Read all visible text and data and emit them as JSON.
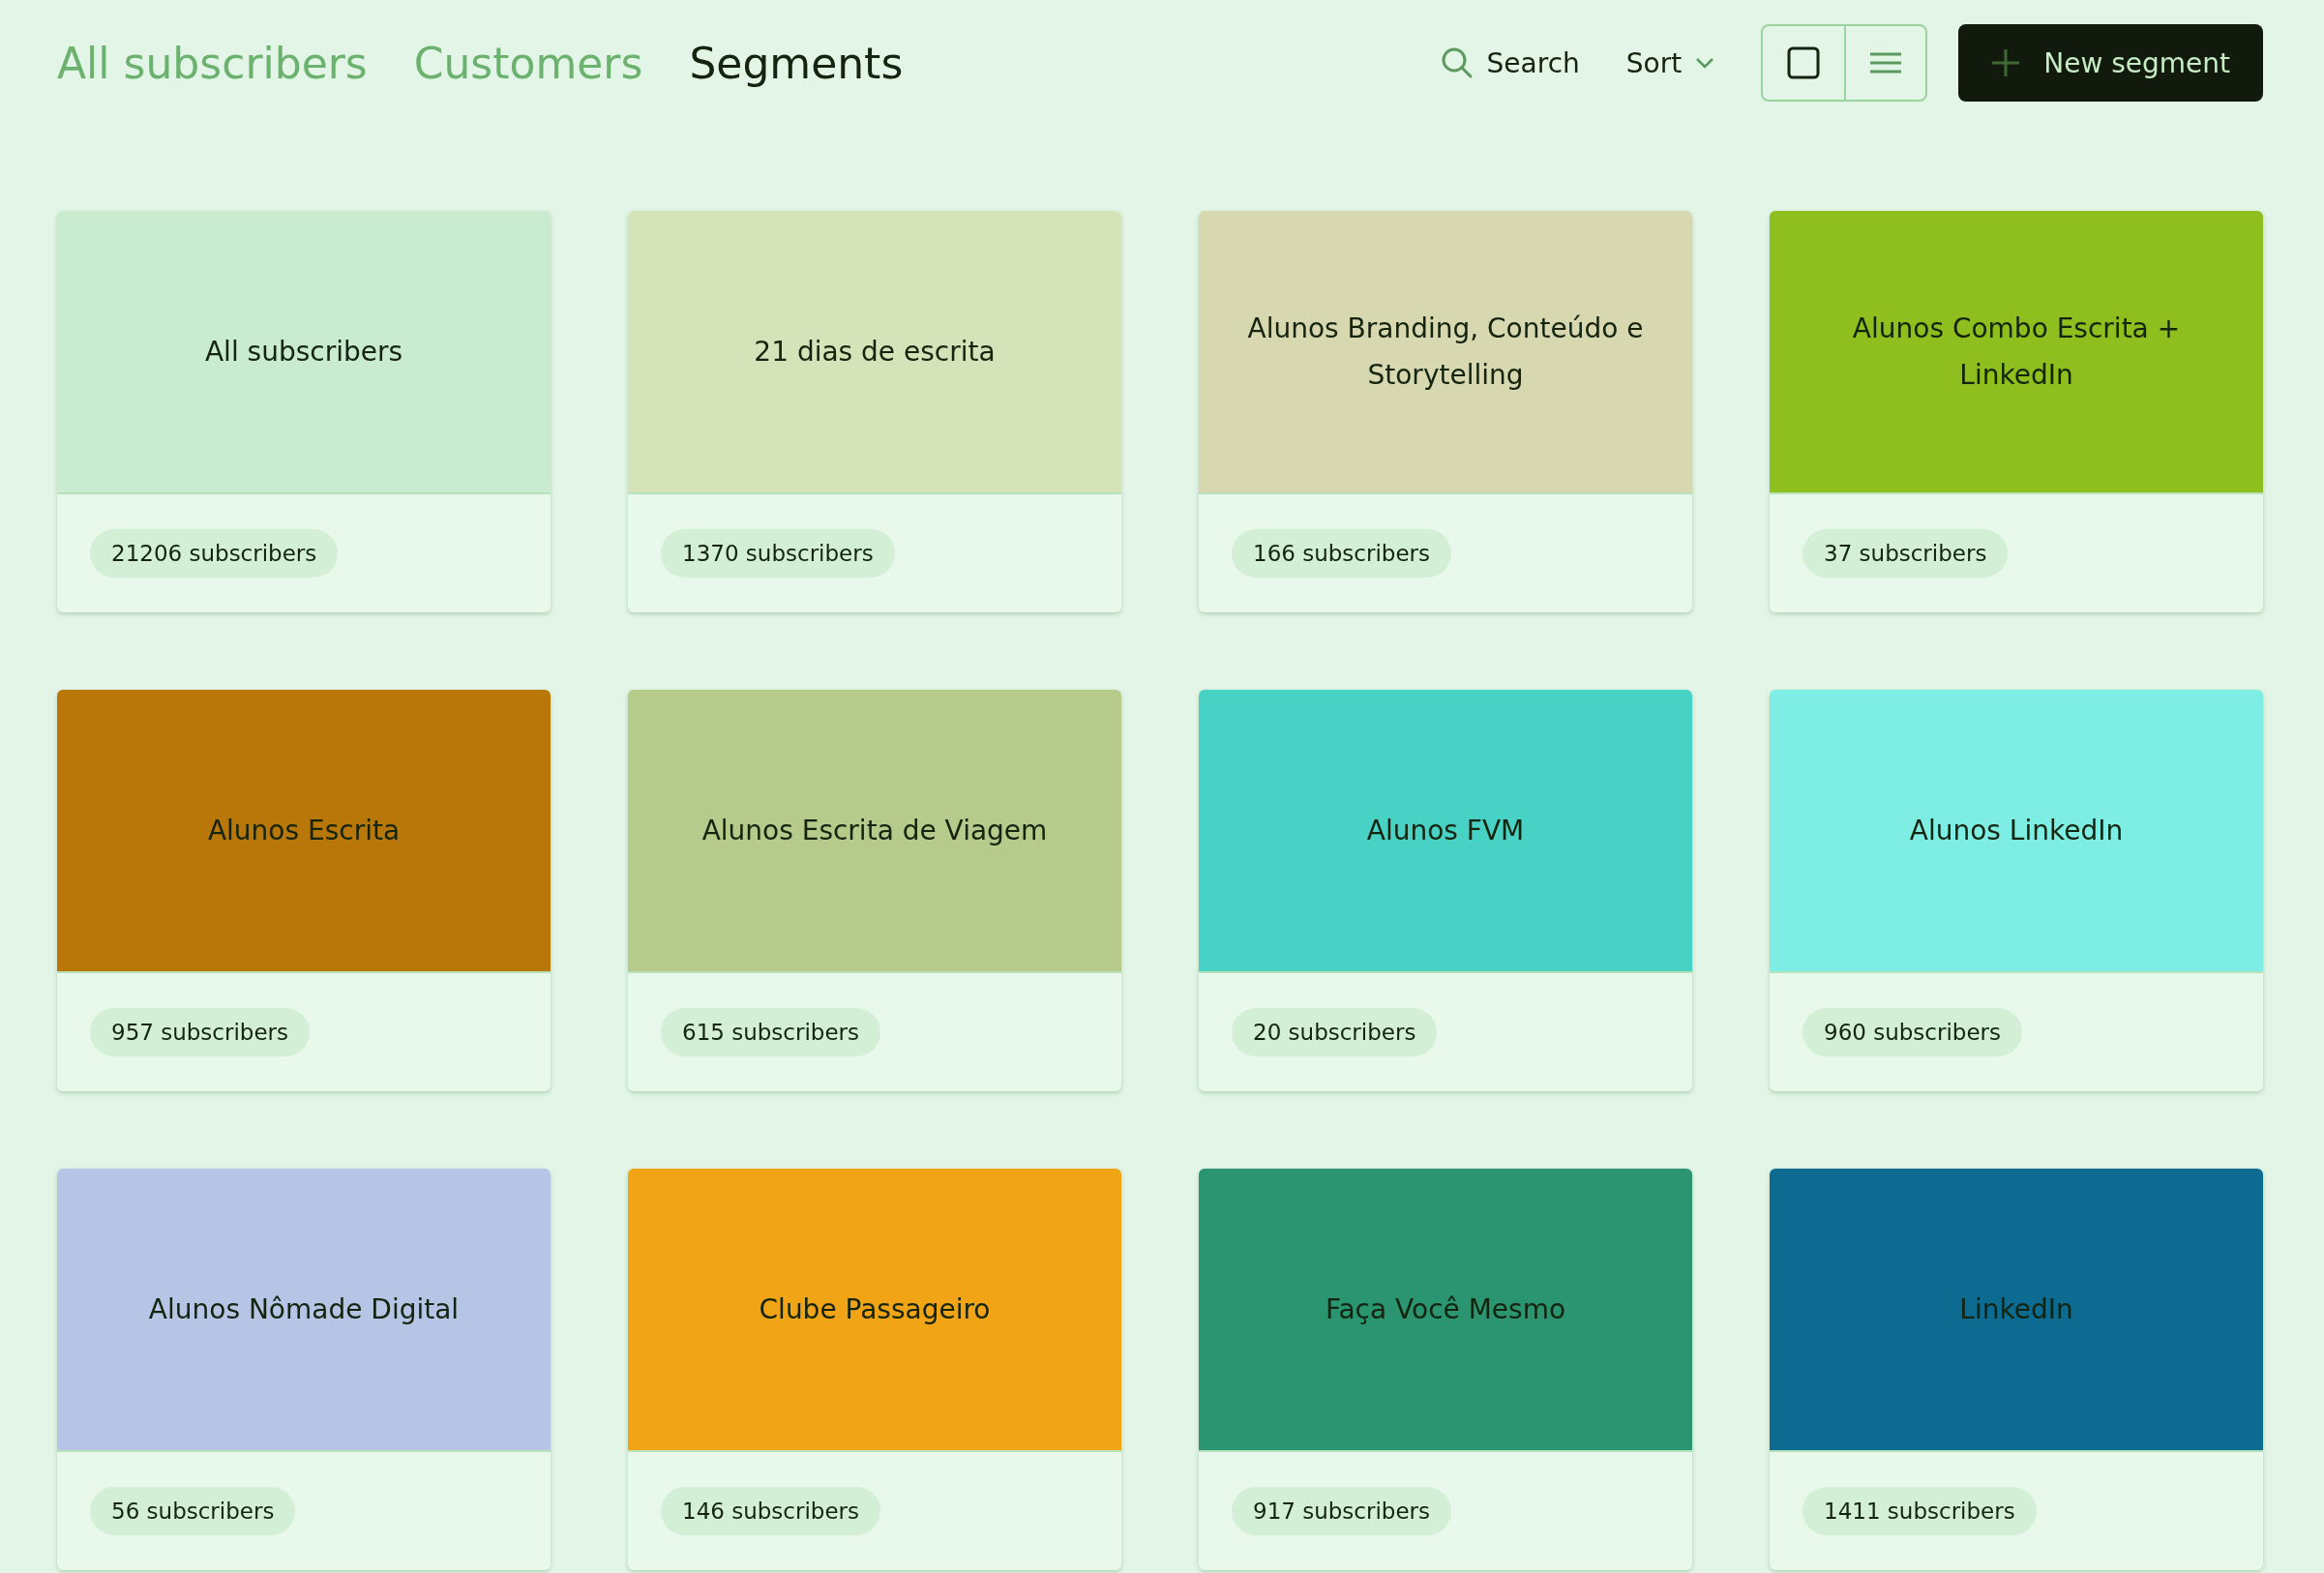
{
  "tabs": [
    {
      "label": "All subscribers",
      "selected": false
    },
    {
      "label": "Customers",
      "selected": false
    },
    {
      "label": "Segments",
      "selected": true
    }
  ],
  "toolbar": {
    "search": "Search",
    "sort": "Sort",
    "views": [
      {
        "kind": "grid",
        "selected": true
      },
      {
        "kind": "list",
        "selected": false
      }
    ],
    "new_button": "New segment"
  },
  "segments": [
    {
      "name": "All subscribers",
      "count": "21206 subscribers",
      "color": "#c9ecd1"
    },
    {
      "name": "21 dias de escrita",
      "count": "1370 subscribers",
      "color": "#d4e4b8"
    },
    {
      "name": "Alunos Branding, Conteúdo e Storytelling",
      "count": "166 subscribers",
      "color": "#d8d8b0"
    },
    {
      "name": "Alunos Combo Escrita + LinkedIn",
      "count": "37 subscribers",
      "color": "#8ebf1e"
    },
    {
      "name": "Alunos Escrita",
      "count": "957 subscribers",
      "color": "#b87708"
    },
    {
      "name": "Alunos Escrita de Viagem",
      "count": "615 subscribers",
      "color": "#b6ca8c"
    },
    {
      "name": "Alunos FVM",
      "count": "20 subscribers",
      "color": "#48d2c6"
    },
    {
      "name": "Alunos LinkedIn",
      "count": "960 subscribers",
      "color": "#7eeee4"
    },
    {
      "name": "Alunos Nômade Digital",
      "count": "56 subscribers",
      "color": "#b6c4e6"
    },
    {
      "name": "Clube Passageiro",
      "count": "146 subscribers",
      "color": "#f0a416"
    },
    {
      "name": "Faça Você Mesmo",
      "count": "917 subscribers",
      "color": "#2a9570"
    },
    {
      "name": "LinkedIn",
      "count": "1411 subscribers",
      "color": "#0d6b92"
    }
  ]
}
